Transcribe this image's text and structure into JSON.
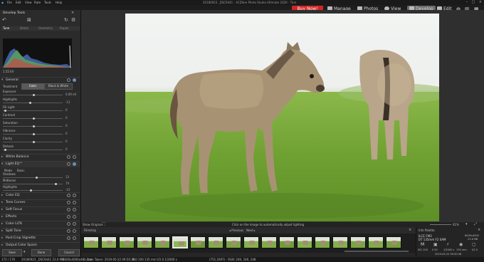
{
  "menu": [
    "File",
    "Edit",
    "View",
    "Rate",
    "Tools",
    "Help"
  ],
  "window_title": "20180923 _DSC9441 - ACDSee Photo Studio Ultimate 2020 - Trial",
  "buy_now": "Buy Now!",
  "modes": {
    "manage": "Manage",
    "photos": "Photos",
    "view": "View",
    "develop": "Develop",
    "edit": "Edit"
  },
  "develop_tools": {
    "title": "Develop Tools",
    "tabs": [
      "Tune",
      "Detail",
      "Geometry",
      "Repair"
    ],
    "histogram_readout": "1.55 EV",
    "general": {
      "title": "General",
      "treatment_label": "Treatment",
      "treatment_options": [
        "Color",
        "Black & White"
      ],
      "sliders": [
        {
          "label": "Exposure",
          "value": "0.00 eV"
        },
        {
          "label": "Highlights",
          "value": "-11"
        },
        {
          "label": "Fill Light",
          "value": "0"
        },
        {
          "label": "Contrast",
          "value": "0"
        },
        {
          "label": "Saturation",
          "value": "0"
        },
        {
          "label": "Vibrance",
          "value": "0"
        },
        {
          "label": "Clarity",
          "value": "0"
        },
        {
          "label": "Dehaze",
          "value": "0"
        }
      ]
    },
    "white_balance": "White Balance",
    "light_eq": {
      "title": "Light EQ™",
      "mode_label": "Mode",
      "mode_value": "Basic",
      "sliders": [
        {
          "label": "Shadows",
          "value": "13"
        },
        {
          "label": "Midtones",
          "value": "74"
        },
        {
          "label": "Highlights",
          "value": "-15"
        }
      ]
    },
    "sections": [
      "Color EQ",
      "Tone Curves",
      "Soft Focus",
      "Effects",
      "Color LUTs",
      "Split Tone",
      "Post-Crop Vignette",
      "Output Color Space"
    ],
    "buttons": {
      "save": "Save",
      "done": "Done",
      "cancel": "Cancel"
    }
  },
  "hint_bar": {
    "show_original": "Show Original",
    "hint": "Click on the image to automatically adjust lighting",
    "zoom": "41%"
  },
  "filmstrip": {
    "title": "Filmstrip",
    "previous": "Previous",
    "next": "Next",
    "thumb_count": 18,
    "selected_index": 5
  },
  "info_palette": {
    "title": "Info Palette",
    "camera": "ILCE-7M3",
    "lens": "DT 135mm F2 SAM",
    "file_size": "6000x4000",
    "file_mb": "23.6 MB",
    "iso": "ISO 100",
    "ev": "0 EV",
    "shutter": "1/2000 s",
    "focal": "135 mm",
    "aperture": "f/2.0",
    "date": "2019-05-22 09:50:36"
  },
  "statusbar": {
    "position": "172 / 176",
    "filename": "20180923 _DSC9441 23.6 MB",
    "resolution": "6000x4000x48b.cnv",
    "date": "Date Taken: 2019-05-22 09:50:36",
    "exposure": "ISO 100   135 mm   f/2.0   1/2000 s",
    "image_info": "(751,1697) - RGB: 246, 246, 248"
  },
  "colors": {
    "accent": "#6a8fb8",
    "buy": "#d12626",
    "grass": "#79a83a"
  }
}
